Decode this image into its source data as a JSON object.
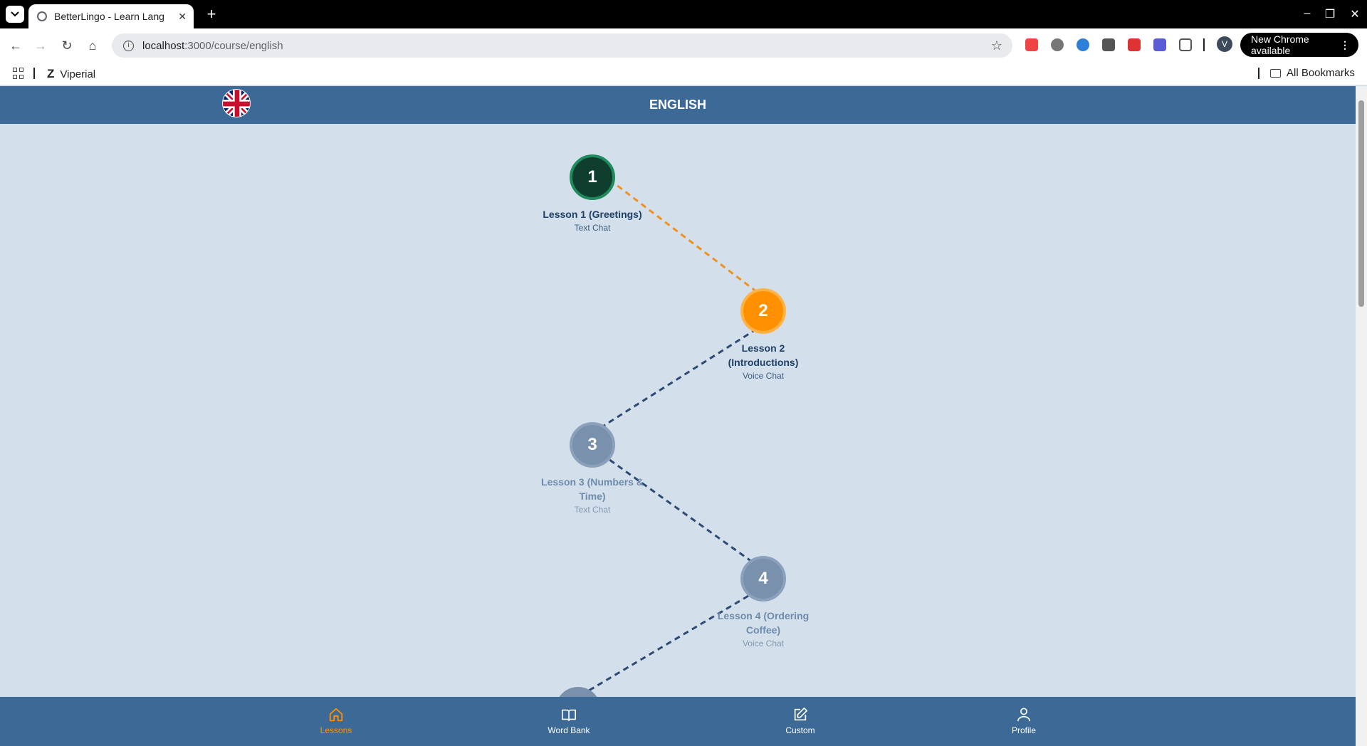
{
  "browser": {
    "tab_title": "BetterLingo - Learn Lang",
    "url_host": "localhost",
    "url_path": ":3000/course/english",
    "new_chrome": "New Chrome available",
    "avatar_letter": "V",
    "bookmarks": [
      {
        "label": "Viperial",
        "glyph": "Z"
      }
    ],
    "all_bookmarks": "All Bookmarks"
  },
  "app": {
    "title": "ENGLISH",
    "lessons": [
      {
        "number": "1",
        "title": "Lesson 1 (Greetings)",
        "mode": "Text Chat",
        "state": "completed"
      },
      {
        "number": "2",
        "title": "Lesson 2 (Introductions)",
        "mode": "Voice Chat",
        "state": "current"
      },
      {
        "number": "3",
        "title": "Lesson 3 (Numbers & Time)",
        "mode": "Text Chat",
        "state": "locked"
      },
      {
        "number": "4",
        "title": "Lesson 4 (Ordering Coffee)",
        "mode": "Voice Chat",
        "state": "locked"
      }
    ],
    "nav": [
      {
        "label": "Lessons",
        "icon": "home-icon",
        "active": true
      },
      {
        "label": "Word Bank",
        "icon": "book-icon",
        "active": false
      },
      {
        "label": "Custom",
        "icon": "edit-icon",
        "active": false
      },
      {
        "label": "Profile",
        "icon": "user-icon",
        "active": false
      }
    ]
  },
  "colors": {
    "header": "#3c6996",
    "background": "#d3e0ec",
    "completed": "#0f3d2e",
    "current": "#ff9100",
    "locked": "#7a91ad"
  }
}
